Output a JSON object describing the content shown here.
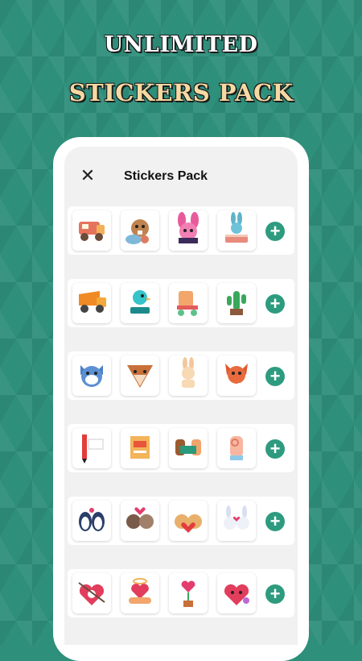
{
  "headline": {
    "line1": "UNLIMITED",
    "line2": "STICKERS PACK"
  },
  "screen": {
    "title": "Stickers Pack",
    "close_icon": "close-icon"
  },
  "packs": [
    {
      "stickers": [
        "truck-sticker",
        "beaver-sticker",
        "bunny-sticker",
        "bunny-cake-sticker"
      ],
      "add_icon": "plus-icon"
    },
    {
      "stickers": [
        "dump-truck-sticker",
        "bird-gym-sticker",
        "roller-skate-sticker",
        "cactus-sticker"
      ],
      "add_icon": "plus-icon"
    },
    {
      "stickers": [
        "cat-face-sticker",
        "fox-face-sticker",
        "bunny-super-star-sticker",
        "fox-well-done-sticker"
      ],
      "add_icon": "plus-icon"
    },
    {
      "stickers": [
        "great-job-pencil-sticker",
        "good-job-paper-sticker",
        "great-hands-sticker",
        "ok-hand-sticker"
      ],
      "add_icon": "plus-icon"
    },
    {
      "stickers": [
        "penguins-sticker",
        "cats-love-sticker",
        "bears-love-sticker",
        "bunnies-love-sticker"
      ],
      "add_icon": "plus-icon"
    },
    {
      "stickers": [
        "heart-arrow-sticker",
        "hands-heart-sticker",
        "heart-plant-sticker",
        "heart-kiss-sticker"
      ],
      "add_icon": "plus-icon"
    }
  ],
  "colors": {
    "background": "#2e8f7b",
    "accent": "#2e9b7f",
    "headline_line1": "#ffffff",
    "headline_line2": "#f6d9a2"
  }
}
